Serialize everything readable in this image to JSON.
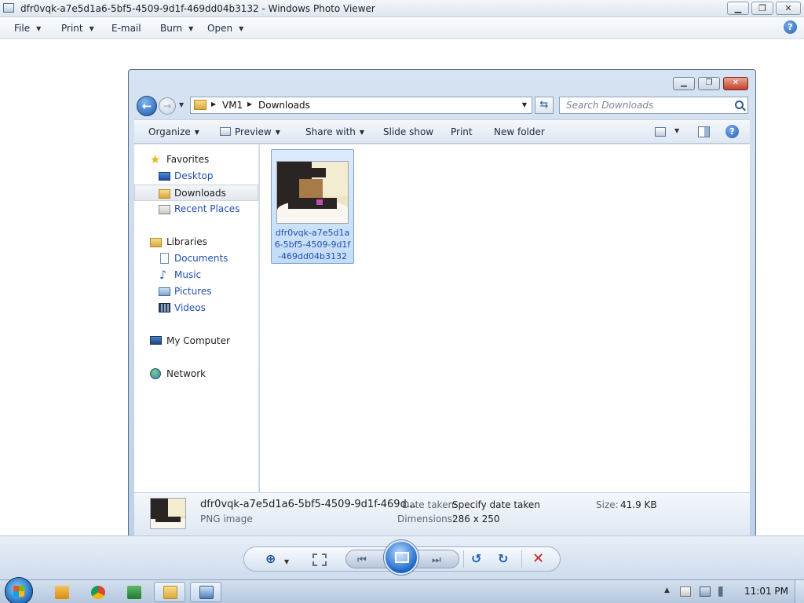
{
  "window": {
    "title": "dfr0vqk-a7e5d1a6-5bf5-4509-9d1f-469dd04b3132 - Windows Photo Viewer",
    "controls": {
      "minimize": "▁",
      "maximize": "❐",
      "close": "✕"
    }
  },
  "menu": {
    "items": [
      {
        "label": "File",
        "has_arrow": true
      },
      {
        "label": "Print",
        "has_arrow": true
      },
      {
        "label": "E-mail",
        "has_arrow": false
      },
      {
        "label": "Burn",
        "has_arrow": true
      },
      {
        "label": "Open",
        "has_arrow": true
      }
    ],
    "help_glyph": "?",
    "arrow_glyph": "▼"
  },
  "explorer": {
    "controls": {
      "minimize": "▁",
      "maximize": "❐",
      "close": "✕"
    },
    "back_glyph": "←",
    "forward_glyph": "→",
    "address": {
      "crumbs": [
        "VM1",
        "Downloads"
      ],
      "separator": "▶",
      "dropdown": "▼"
    },
    "refresh_glyph": "⇆",
    "search_placeholder": "Search Downloads",
    "toolbar": {
      "organize": "Organize",
      "preview": "Preview",
      "share_with": "Share with",
      "slide_show": "Slide show",
      "print": "Print",
      "new_folder": "New folder",
      "help_glyph": "?"
    },
    "nav": {
      "favorites": {
        "label": "Favorites",
        "items": [
          "Desktop",
          "Downloads",
          "Recent Places"
        ],
        "selected": "Downloads"
      },
      "libraries": {
        "label": "Libraries",
        "items": [
          "Documents",
          "Music",
          "Pictures",
          "Videos"
        ]
      },
      "computer": "My Computer",
      "network": "Network"
    },
    "file": {
      "name": "dfr0vqk-a7e5d1a6-5bf5-4509-9d1f-469dd04b3132",
      "name_lines": [
        "dfr0vqk-a7e5d1a",
        "6-5bf5-4509-9d1f",
        "-469dd04b3132"
      ]
    },
    "details": {
      "name_truncated": "dfr0vqk-a7e5d1a6-5bf5-4509-9d1f-469d...",
      "type": "PNG image",
      "date_taken_label": "Date taken:",
      "date_taken_value": "Specify date taken",
      "dimensions_label": "Dimensions:",
      "dimensions_value": "286 x 250",
      "size_label": "Size:",
      "size_value": "41.9 KB"
    }
  },
  "viewer_controls": {
    "zoom_glyph": "⊕",
    "fit_glyph": "",
    "prev_glyph": "⏮",
    "next_glyph": "⏭",
    "rotate_ccw_glyph": "↺",
    "rotate_cw_glyph": "↻",
    "delete_glyph": "✕",
    "arrow_glyph": "▼"
  },
  "taskbar": {
    "clock": "11:01 PM",
    "tray_up_glyph": "▲",
    "apps": [
      {
        "name": "media-player",
        "color": "#e8a21d",
        "active": false
      },
      {
        "name": "chrome",
        "color": "#db4437",
        "active": false
      },
      {
        "name": "excel",
        "color": "#2e8b3d",
        "active": false
      },
      {
        "name": "explorer",
        "color": "#e7c35a",
        "active": true
      },
      {
        "name": "photo-viewer",
        "color": "#4f7fb8",
        "active": true
      }
    ]
  },
  "colors": {
    "accent": "#1f5db3",
    "link": "#1f4fb0",
    "selection": "#c3dcf6",
    "delete": "#c9221a"
  }
}
